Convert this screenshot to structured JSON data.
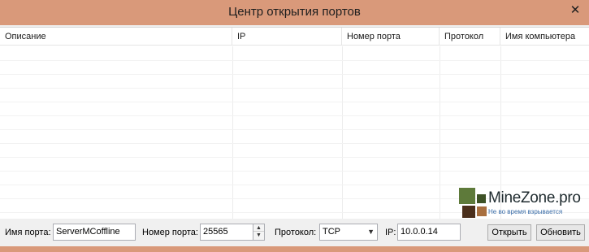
{
  "window": {
    "title": "Центр открытия портов",
    "close_glyph": "✕"
  },
  "table": {
    "columns": [
      "Описание",
      "IP",
      "Номер порта",
      "Протокол",
      "Имя компьютера"
    ]
  },
  "form": {
    "port_name_label": "Имя порта:",
    "port_name_value": "ServerMCoffline",
    "port_number_label": "Номер порта:",
    "port_number_value": "25565",
    "protocol_label": "Протокол:",
    "protocol_value": "TCP",
    "ip_label": "IP:",
    "ip_value": "10.0.0.14",
    "open_button": "Открыть",
    "refresh_button": "Обновить"
  },
  "watermark": {
    "text": "MineZone.pro",
    "subtext": "Не во время взрывается"
  },
  "colors": {
    "titlebar": "#d9997a",
    "client": "#f0f0f0",
    "grid": "#ffffff",
    "watermark_green": "#5e7a3a",
    "watermark_brown": "#4b2f1c"
  }
}
